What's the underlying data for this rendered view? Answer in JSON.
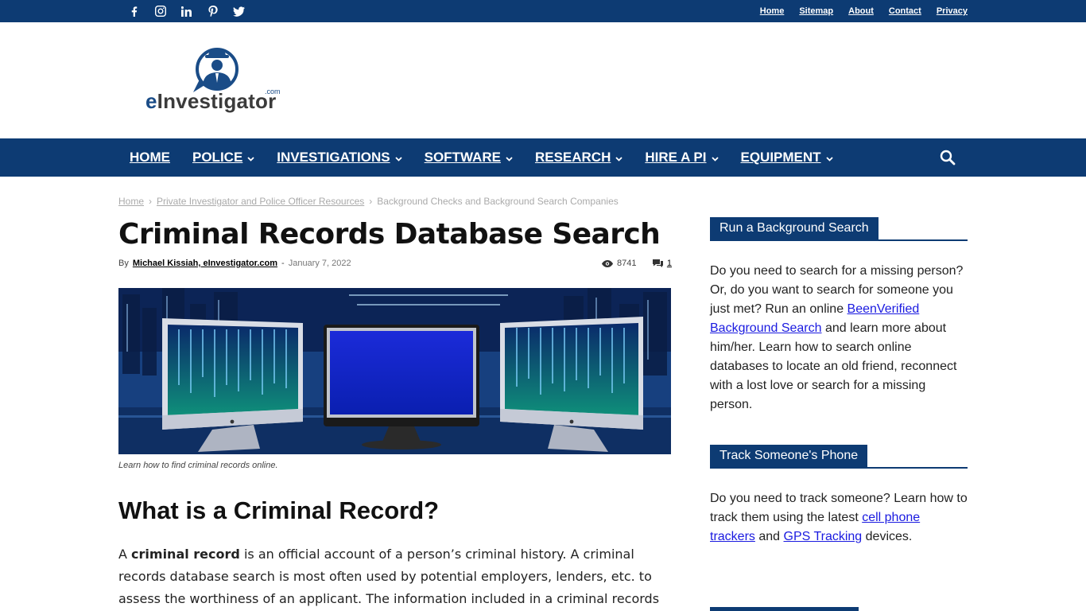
{
  "topbar": {
    "social": [
      {
        "name": "facebook-icon"
      },
      {
        "name": "instagram-icon"
      },
      {
        "name": "linkedin-icon"
      },
      {
        "name": "pinterest-icon"
      },
      {
        "name": "twitter-icon"
      }
    ],
    "links": [
      "Home",
      "Sitemap",
      "About",
      "Contact",
      "Privacy"
    ]
  },
  "logo": {
    "e": "e",
    "rest": "Investigator",
    "com": ".com"
  },
  "nav": {
    "items": [
      {
        "label": "HOME",
        "dropdown": false
      },
      {
        "label": "POLICE",
        "dropdown": true
      },
      {
        "label": "INVESTIGATIONS",
        "dropdown": true
      },
      {
        "label": "SOFTWARE",
        "dropdown": true
      },
      {
        "label": "RESEARCH",
        "dropdown": true
      },
      {
        "label": "HIRE A PI",
        "dropdown": true
      },
      {
        "label": "EQUIPMENT",
        "dropdown": true
      }
    ]
  },
  "breadcrumb": {
    "items": [
      "Home",
      "Private Investigator and Police Officer Resources",
      "Background Checks and Background Search Companies"
    ],
    "sep": "›"
  },
  "article": {
    "title": "Criminal Records Database Search",
    "by": "By",
    "author": "Michael Kissiah, eInvestigator.com",
    "dash": "-",
    "date": "January 7, 2022",
    "views": "8741",
    "comments": "1",
    "caption": "Learn how to find criminal records online.",
    "h2": "What is a Criminal Record?",
    "para_a": "A ",
    "para_bold": "criminal record",
    "para_b": " is an official account of a person’s criminal history. A criminal records database search is most often used by potential employers, lenders, etc. to assess the worthiness of an applicant. The information included in a criminal records"
  },
  "sidebar": {
    "w1": {
      "title": "Run a Background Search",
      "t1": "Do you need to search for a missing person? Or, do you want to search for someone you just met? Run an online ",
      "link": "BeenVerified Background Search",
      "t2": " and learn more about him/her. Learn how to search online databases to locate an old friend, reconnect with a lost love or search for a missing person."
    },
    "w2": {
      "title": "Track Someone's Phone",
      "t1": "Do you need to track someone? Learn how to track them using the latest ",
      "link1": "cell phone trackers",
      "t2": " and ",
      "link2": "GPS Tracking",
      "t3": " devices."
    }
  },
  "colors": {
    "brand": "#0d3b73",
    "link": "#1a1ae0"
  }
}
